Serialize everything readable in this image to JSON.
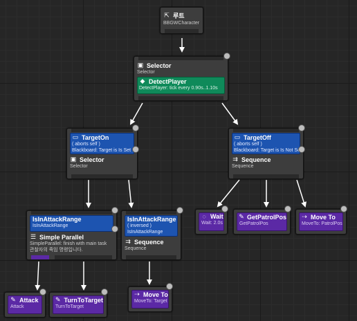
{
  "root": {
    "title": "루트",
    "subtitle": "BBGWCharacter"
  },
  "selector_main": {
    "title": "Selector",
    "subtitle": "Selector",
    "service": {
      "title": "DetectPlayer",
      "subtitle": "DetectPlayer: tick every 0.90s..1.10s"
    }
  },
  "target_on": {
    "decorator": {
      "title": "TargetOn",
      "aborts": "( aborts self )",
      "desc": "Blackboard: Target is Is Set"
    },
    "title": "Selector",
    "subtitle": "Selector"
  },
  "target_off": {
    "decorator": {
      "title": "TargetOff",
      "aborts": "( aborts self )",
      "desc": "Blackboard: Target is Is Not Set"
    },
    "title": "Sequence",
    "subtitle": "Sequence"
  },
  "in_range": {
    "decorator": {
      "title": "IsInAttackRange",
      "desc": "IsInAttackRange"
    },
    "title": "Simple Parallel",
    "subtitle": "SimpleParallel: finish with main task",
    "subtitle2": "관찰자의 죽임 명령입니다."
  },
  "in_range_inv": {
    "decorator": {
      "title": "IsInAttackRange",
      "inversed": "( inversed )",
      "desc": "IsInAttackRange"
    },
    "title": "Sequence",
    "subtitle": "Sequence"
  },
  "tasks": {
    "wait": {
      "title": "Wait",
      "subtitle": "Wait: 2.0s"
    },
    "patrol": {
      "title": "GetPatrolPos",
      "subtitle": "GetPatrolPos"
    },
    "moveto_patrol": {
      "title": "Move To",
      "subtitle": "MoveTo: PatrolPos"
    },
    "attack": {
      "title": "Attack",
      "subtitle": "Attack"
    },
    "turn": {
      "title": "TurnToTarget",
      "subtitle": "TurnToTarget"
    },
    "moveto_target": {
      "title": "Move To",
      "subtitle": "MoveTo: Target"
    }
  },
  "colors": {
    "decorator": "#1d54b0",
    "service": "#0f8a5a",
    "task": "#5b29a5",
    "node": "#3d3d3d",
    "wire": "#ffffff"
  },
  "icons": {
    "root": "tree-root-icon",
    "selector": "selector-icon",
    "sequence": "sequence-icon",
    "decorator": "blackboard-icon",
    "service": "service-icon",
    "wait": "wait-icon",
    "task": "task-icon",
    "move": "move-to-icon"
  }
}
